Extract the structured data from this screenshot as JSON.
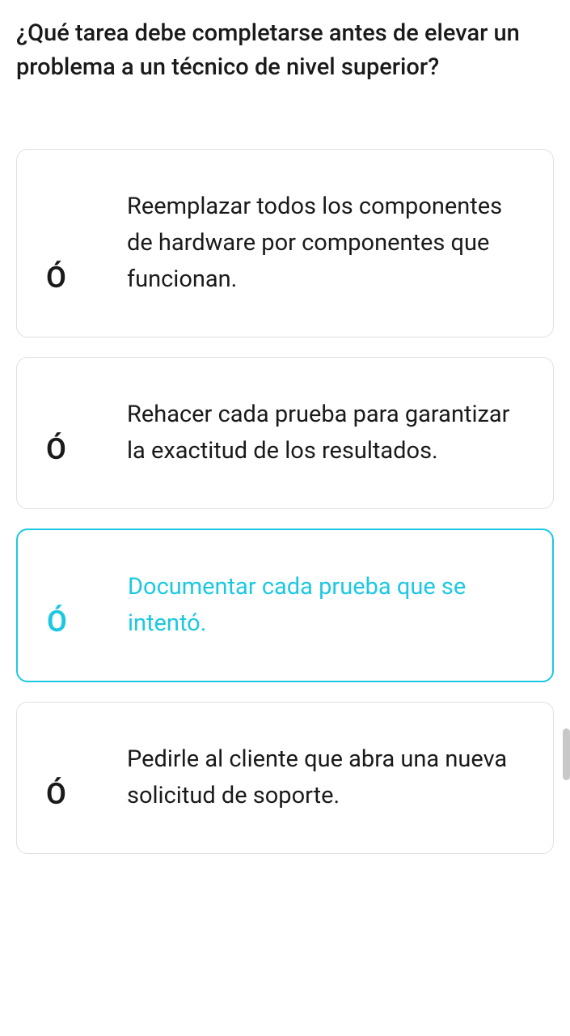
{
  "question": "¿Qué tarea debe completarse antes de elevar un problema a un técnico de nivel superior?",
  "options": [
    {
      "marker": "Ó",
      "text": "Reemplazar todos los componentes de hardware por componentes que funcionan.",
      "selected": false
    },
    {
      "marker": "Ó",
      "text": "Rehacer cada prueba para garantizar la exactitud de los resultados.",
      "selected": false
    },
    {
      "marker": "Ó",
      "text": "Documentar cada prueba que se intentó.",
      "selected": true
    },
    {
      "marker": "Ó",
      "text": "Pedirle al cliente que abra una nueva solicitud de soporte.",
      "selected": false
    }
  ],
  "colors": {
    "accent": "#1cc8e1",
    "border_default": "#e0e0e0",
    "text_default": "#1a1a1a"
  }
}
